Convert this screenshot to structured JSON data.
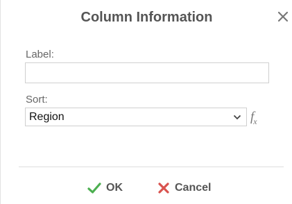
{
  "dialog": {
    "title": "Column Information"
  },
  "label_field": {
    "caption": "Label:",
    "value": "",
    "placeholder": ""
  },
  "sort_field": {
    "caption": "Sort:",
    "selected_value": "Region"
  },
  "buttons": {
    "ok_label": "OK",
    "cancel_label": "Cancel"
  },
  "icons": {
    "close": "close-icon",
    "chevron": "chevron-down-icon",
    "formula": "fx-icon",
    "ok": "checkmark-icon",
    "cancel": "x-icon"
  },
  "colors": {
    "ok_green": "#4caf50",
    "cancel_red": "#d9534f",
    "title_gray": "#555555"
  }
}
